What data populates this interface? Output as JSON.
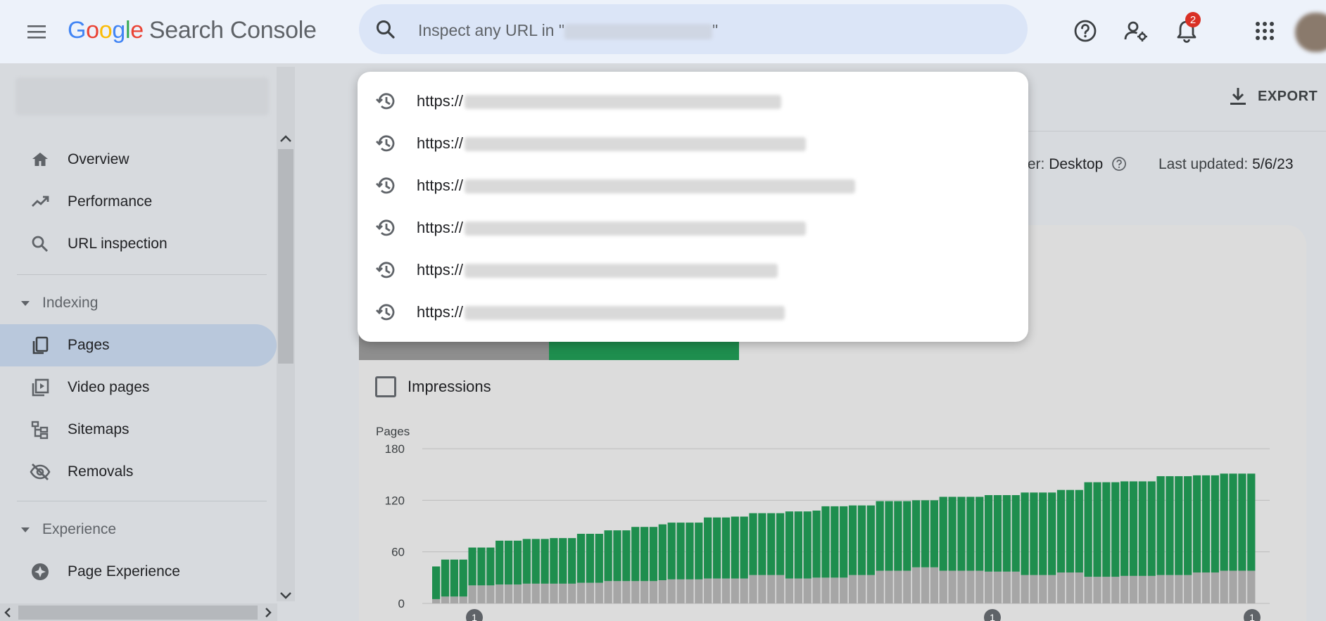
{
  "app": {
    "logo_letters": [
      "G",
      "o",
      "o",
      "g",
      "l",
      "e"
    ],
    "product_name": "Search Console"
  },
  "search": {
    "placeholder_prefix": "Inspect any URL in \"",
    "placeholder_suffix": "\""
  },
  "topbar": {
    "icons": [
      "menu-icon",
      "search-icon",
      "help-icon",
      "manage-users-icon",
      "notifications-icon",
      "apps-grid-icon"
    ],
    "notification_count": "2"
  },
  "search_history": {
    "items": [
      {
        "prefix": "https://"
      },
      {
        "prefix": "https://"
      },
      {
        "prefix": "https://"
      },
      {
        "prefix": "https://"
      },
      {
        "prefix": "https://"
      },
      {
        "prefix": "https://"
      }
    ]
  },
  "sidebar": {
    "items": [
      {
        "label": "Overview",
        "icon": "home-icon"
      },
      {
        "label": "Performance",
        "icon": "trending-up-icon"
      },
      {
        "label": "URL inspection",
        "icon": "search-icon"
      }
    ],
    "sections": [
      {
        "title": "Indexing",
        "items": [
          {
            "label": "Pages",
            "icon": "pages-icon",
            "active": true
          },
          {
            "label": "Video pages",
            "icon": "video-pages-icon"
          },
          {
            "label": "Sitemaps",
            "icon": "sitemap-icon"
          },
          {
            "label": "Removals",
            "icon": "eye-off-icon"
          }
        ]
      },
      {
        "title": "Experience",
        "items": [
          {
            "label": "Page Experience",
            "icon": "page-experience-icon"
          }
        ]
      }
    ]
  },
  "main": {
    "export_label": "EXPORT",
    "crawler_label_partial": "wler: ",
    "crawler_value": "Desktop",
    "last_updated_label": "Last updated: ",
    "last_updated_value": "5/6/23",
    "impressions_label": "Impressions",
    "impressions_checked": false,
    "annotation_markers": [
      "1",
      "1",
      "1"
    ]
  },
  "colors": {
    "indexed": "#1e8e4e",
    "not_indexed": "#a6a6a6",
    "accent": "#1a73e8",
    "badge": "#d93025"
  },
  "chart_data": {
    "type": "bar",
    "stacked": true,
    "ylabel": "Pages",
    "yticks": [
      0,
      60,
      120,
      180
    ],
    "ylim": [
      0,
      180
    ],
    "grid": true,
    "series": [
      {
        "values": [
          5,
          8,
          8,
          8,
          21,
          21,
          21,
          22,
          22,
          22,
          23,
          23,
          23,
          23,
          23,
          23,
          24,
          24,
          24,
          26,
          26,
          26,
          26,
          26,
          26,
          27,
          28,
          28,
          28,
          28,
          29,
          29,
          29,
          29,
          29,
          33,
          33,
          33,
          33,
          29,
          29,
          29,
          30,
          30,
          30,
          30,
          33,
          33,
          33,
          38,
          38,
          38,
          38,
          42,
          42,
          42,
          38,
          38,
          38,
          38,
          38,
          37,
          37,
          37,
          37,
          33,
          33,
          33,
          33,
          36,
          36,
          36,
          31,
          31,
          31,
          31,
          32,
          32,
          32,
          32,
          33,
          33,
          33,
          33,
          36,
          36,
          36,
          38,
          38,
          38,
          38
        ]
      },
      {
        "values": [
          38,
          43,
          43,
          43,
          44,
          44,
          44,
          51,
          51,
          51,
          52,
          52,
          52,
          53,
          53,
          53,
          57,
          57,
          57,
          59,
          59,
          59,
          63,
          63,
          63,
          65,
          66,
          66,
          66,
          66,
          71,
          71,
          71,
          72,
          72,
          72,
          72,
          72,
          72,
          78,
          78,
          78,
          78,
          83,
          83,
          83,
          81,
          81,
          81,
          81,
          81,
          81,
          81,
          78,
          78,
          78,
          86,
          86,
          86,
          86,
          86,
          89,
          89,
          89,
          89,
          96,
          96,
          96,
          96,
          96,
          96,
          96,
          110,
          110,
          110,
          110,
          110,
          110,
          110,
          110,
          115,
          115,
          115,
          115,
          113,
          113,
          113,
          113,
          113,
          113,
          113
        ]
      }
    ]
  }
}
